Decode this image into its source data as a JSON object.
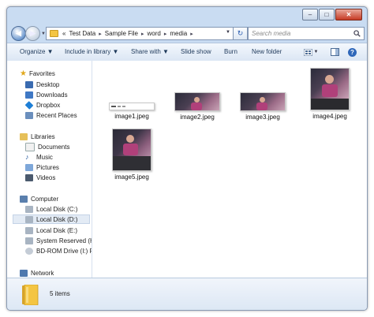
{
  "window": {
    "minimize": "–",
    "maximize": "□",
    "close": "✕"
  },
  "navigation": {
    "back_arrow": "◀",
    "forward_arrow": "▶",
    "recent_dropdown": "▼"
  },
  "address": {
    "overflow": "«",
    "segments": [
      "Test Data",
      "Sample File",
      "word",
      "media"
    ],
    "separator": "▸",
    "dropdown": "▼",
    "refresh_glyph": "↻"
  },
  "search": {
    "placeholder": "Search media",
    "icon": "search-icon"
  },
  "toolbar": {
    "organize": "Organize ▼",
    "include_in_library": "Include in library ▼",
    "share_with": "Share with ▼",
    "slide_show": "Slide show",
    "burn": "Burn",
    "new_folder": "New folder",
    "view_dropdown": "▼",
    "help_glyph": "?"
  },
  "sidebar": {
    "favorites": "Favorites",
    "favorite_items": [
      "Desktop",
      "Downloads",
      "Dropbox",
      "Recent Places"
    ],
    "libraries": "Libraries",
    "library_items": [
      "Documents",
      "Music",
      "Pictures",
      "Videos"
    ],
    "computer": "Computer",
    "computer_items": [
      "Local Disk (C:)",
      "Local Disk (D:)",
      "Local Disk (E:)",
      "System Reserved (H:",
      "BD-ROM Drive (I:) P:"
    ],
    "selected": "Local Disk (D:)",
    "network": "Network"
  },
  "files": [
    {
      "name": "image1.jpeg"
    },
    {
      "name": "image2.jpeg"
    },
    {
      "name": "image3.jpeg"
    },
    {
      "name": "image4.jpeg"
    },
    {
      "name": "image5.jpeg"
    }
  ],
  "status": {
    "item_count": "5 items"
  },
  "colors": {
    "folder": "#f4c542",
    "selection": "#e3ebf5",
    "toolbar_text": "#1e395b"
  }
}
